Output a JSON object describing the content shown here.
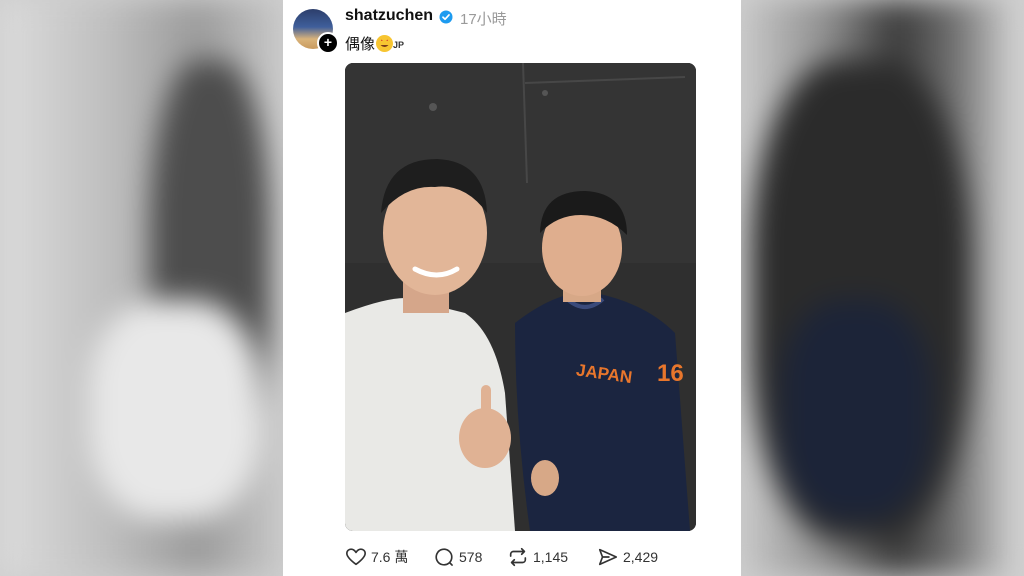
{
  "post": {
    "username": "shatzuchen",
    "timestamp": "17小時",
    "caption_text": "偶像",
    "caption_flag": "JP",
    "caption_emoji": "star-struck-emoji"
  },
  "photo": {
    "jersey_text": "JAPAN",
    "jersey_number": "16"
  },
  "actions": {
    "likes": "7.6 萬",
    "comments": "578",
    "reposts": "1,145",
    "shares": "2,429"
  },
  "colors": {
    "verified": "#1d9bf0",
    "wall": "#2f2f2f",
    "jersey": "#1b2540",
    "jersey_text": "#e8762c"
  }
}
